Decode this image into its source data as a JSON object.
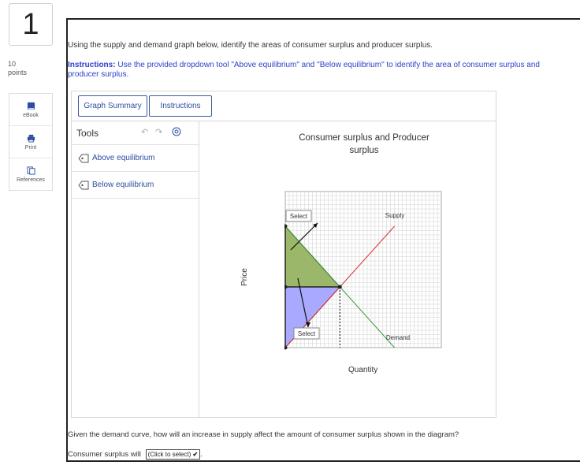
{
  "question": {
    "number": "1",
    "points_value": "10",
    "points_label": "points",
    "prompt": "Using the supply and demand graph below, identify the areas of consumer surplus and producer surplus.",
    "instructions_label": "Instructions:",
    "instructions_text": " Use the provided dropdown tool \"Above equilibrium\" and \"Below equilibrium\" to identify the area of consumer surplus and producer surplus.",
    "followup": "Given the demand curve, how will an increase in supply affect the amount of consumer surplus shown in the diagram?",
    "answer_prefix": "Consumer surplus will",
    "answer_select": "(Click to select)",
    "answer_suffix": "."
  },
  "side_tools": [
    {
      "label": "eBook",
      "icon": "book-icon"
    },
    {
      "label": "Print",
      "icon": "printer-icon"
    },
    {
      "label": "References",
      "icon": "references-icon"
    }
  ],
  "tabs": [
    {
      "label": "Graph Summary"
    },
    {
      "label": "Instructions"
    }
  ],
  "tools_panel": {
    "title": "Tools",
    "items": [
      {
        "label": "Above equilibrium",
        "icon": "tag-icon"
      },
      {
        "label": "Below equilibrium",
        "icon": "tag-icon"
      }
    ]
  },
  "chart": {
    "title": "Consumer surplus and Producer surplus",
    "title_line1": "Consumer surplus and Producer",
    "title_line2": "surplus",
    "xlabel": "Quantity",
    "ylabel": "Price",
    "supply_label": "Supply",
    "demand_label": "Demand",
    "select_top": "Select",
    "select_bottom": "Select",
    "colors": {
      "supply": "#e03030",
      "demand": "#3a9a3a",
      "consumer_fill": "#9bb76a",
      "producer_fill": "#a9a9ff"
    }
  },
  "chart_data": {
    "type": "line",
    "title": "Consumer surplus and Producer surplus",
    "xlabel": "Quantity",
    "ylabel": "Price",
    "xlim": [
      0,
      20
    ],
    "ylim": [
      0,
      18
    ],
    "grid": true,
    "series": [
      {
        "name": "Supply",
        "x": [
          0,
          7,
          14
        ],
        "y": [
          0,
          7,
          14
        ]
      },
      {
        "name": "Demand",
        "x": [
          0,
          7,
          14
        ],
        "y": [
          14,
          7,
          0
        ]
      }
    ]
  }
}
